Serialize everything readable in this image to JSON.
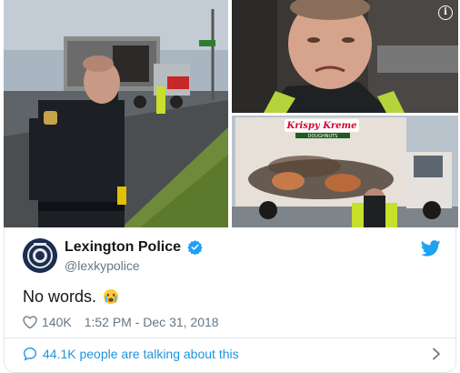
{
  "media": {
    "photos": [
      "officer-by-burnt-truck",
      "officer-closeup-face",
      "burnt-krispy-kreme-truck"
    ],
    "info_icon": "info-icon",
    "truck_logo_text": "Krispy Kreme",
    "truck_logo_subtext": "DOUGHNUTS"
  },
  "tweet": {
    "display_name": "Lexington Police",
    "handle": "@lexkypolice",
    "text": "No words.",
    "emoji": "crying-face-icon",
    "likes": "140K",
    "timestamp": "1:52 PM - Dec 31, 2018",
    "talking": "44.1K people are talking about this"
  },
  "colors": {
    "link_blue": "#1b95e0",
    "twitter_blue": "#1da1f2",
    "muted": "#657786",
    "border": "#e1e8ed"
  }
}
